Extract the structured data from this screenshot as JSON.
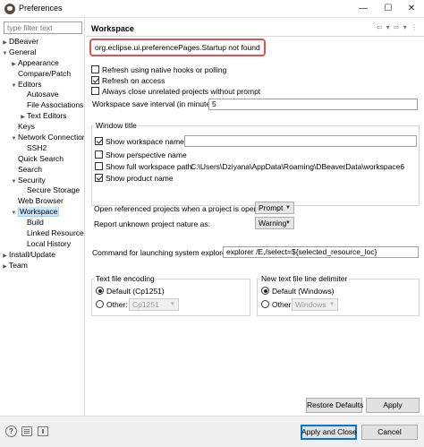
{
  "window": {
    "title": "Preferences",
    "min_glyph": "—",
    "max_glyph": "☐",
    "close_glyph": "✕"
  },
  "sidebar": {
    "filter_placeholder": "type filter text",
    "tree": [
      {
        "label": "DBeaver",
        "depth": 0,
        "twisty": "collapsed"
      },
      {
        "label": "General",
        "depth": 0,
        "twisty": "expanded"
      },
      {
        "label": "Appearance",
        "depth": 1,
        "twisty": "collapsed"
      },
      {
        "label": "Compare/Patch",
        "depth": 1,
        "twisty": "none"
      },
      {
        "label": "Editors",
        "depth": 1,
        "twisty": "expanded"
      },
      {
        "label": "Autosave",
        "depth": 2,
        "twisty": "none"
      },
      {
        "label": "File Associations",
        "depth": 2,
        "twisty": "none"
      },
      {
        "label": "Text Editors",
        "depth": 2,
        "twisty": "collapsed"
      },
      {
        "label": "Keys",
        "depth": 1,
        "twisty": "none"
      },
      {
        "label": "Network Connections",
        "depth": 1,
        "twisty": "expanded"
      },
      {
        "label": "SSH2",
        "depth": 2,
        "twisty": "none"
      },
      {
        "label": "Quick Search",
        "depth": 1,
        "twisty": "none"
      },
      {
        "label": "Search",
        "depth": 1,
        "twisty": "none"
      },
      {
        "label": "Security",
        "depth": 1,
        "twisty": "expanded"
      },
      {
        "label": "Secure Storage",
        "depth": 2,
        "twisty": "none"
      },
      {
        "label": "Web Browser",
        "depth": 1,
        "twisty": "none"
      },
      {
        "label": "Workspace",
        "depth": 1,
        "twisty": "expanded",
        "selected": true
      },
      {
        "label": "Build",
        "depth": 2,
        "twisty": "none"
      },
      {
        "label": "Linked Resources",
        "depth": 2,
        "twisty": "none"
      },
      {
        "label": "Local History",
        "depth": 2,
        "twisty": "none"
      },
      {
        "label": "Install/Update",
        "depth": 0,
        "twisty": "collapsed"
      },
      {
        "label": "Team",
        "depth": 0,
        "twisty": "collapsed"
      }
    ]
  },
  "page": {
    "title": "Workspace",
    "nav_icons": "⇦ ▾ ⇨ ▾ ⋮",
    "error_message": "org.eclipse.ui.preferencePages.Startup not found",
    "refresh_native": {
      "label": "Refresh using native hooks or polling",
      "checked": false
    },
    "refresh_access": {
      "label": "Refresh on access",
      "checked": true
    },
    "close_unrelated": {
      "label": "Always close unrelated projects without prompt",
      "checked": false
    },
    "save_interval": {
      "label": "Workspace save interval (in minutes):",
      "value": "5"
    },
    "window_title": {
      "group_label": "Window title",
      "show_workspace_name": {
        "label": "Show workspace name:",
        "checked": true,
        "value": ""
      },
      "show_perspective_name": {
        "label": "Show perspective name",
        "checked": false
      },
      "show_workspace_path": {
        "label": "Show full workspace path:",
        "checked": false,
        "value": "C:\\Users\\Dziyana\\AppData\\Roaming\\DBeaverData\\workspace6"
      },
      "show_product_name": {
        "label": "Show product name",
        "checked": true
      }
    },
    "open_referenced": {
      "label": "Open referenced projects when a project is opened:",
      "value": "Prompt"
    },
    "unknown_nature": {
      "label": "Report unknown project nature as:",
      "value": "Warning"
    },
    "explorer_cmd": {
      "label": "Command for launching system explorer:",
      "value": "explorer /E,/select=${selected_resource_loc}"
    },
    "text_encoding": {
      "group_label": "Text file encoding",
      "default_label": "Default (Cp1251)",
      "other_label": "Other:",
      "other_value": "Cp1251",
      "selected": "default"
    },
    "line_delimiter": {
      "group_label": "New text file line delimiter",
      "default_label": "Default (Windows)",
      "other_label": "Other:",
      "other_value": "Windows",
      "selected": "default"
    },
    "restore_defaults": "Restore Defaults",
    "apply": "Apply"
  },
  "footer": {
    "help_glyph": "?",
    "apply_close": "Apply and Close",
    "cancel": "Cancel"
  }
}
